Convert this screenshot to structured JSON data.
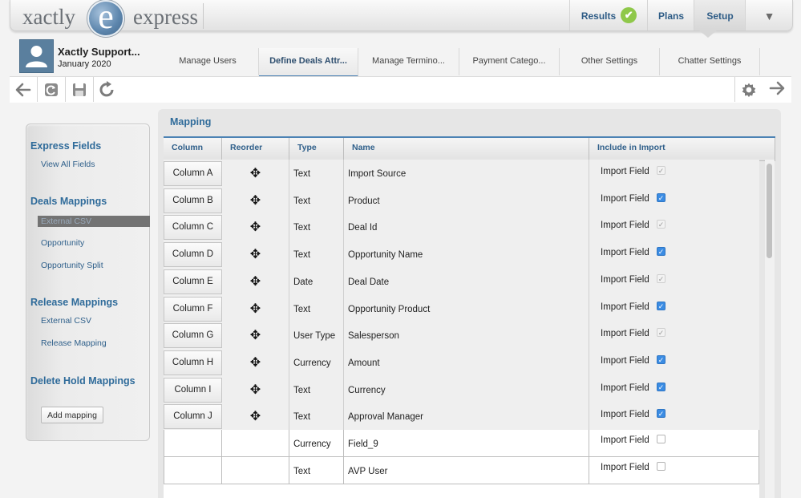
{
  "app": {
    "logo_left": "xactly",
    "logo_mark": "e",
    "logo_right": "express"
  },
  "topnav": {
    "results": "Results",
    "plans": "Plans",
    "setup": "Setup",
    "menu_icon": "▼"
  },
  "user": {
    "name": "Xactly Support...",
    "date": "January 2020"
  },
  "tabs": [
    {
      "label": "Manage Users"
    },
    {
      "label": "Define Deals Attr..."
    },
    {
      "label": "Manage Termino..."
    },
    {
      "label": "Payment Catego..."
    },
    {
      "label": "Other Settings"
    },
    {
      "label": "Chatter Settings"
    }
  ],
  "toolbar": {
    "icons": [
      "back-arrow-icon",
      "refresh-icon",
      "save-icon",
      "redo-icon",
      "gear-icon",
      "forward-arrow-icon"
    ]
  },
  "sidebar": {
    "express_fields": "Express Fields",
    "view_all_fields": "View All Fields",
    "deals_mappings": "Deals Mappings",
    "external_csv_active": "External CSV",
    "opportunity": "Opportunity",
    "opportunity_split": "Opportunity Split",
    "release_mappings": "Release Mappings",
    "release_external_csv": "External CSV",
    "release_mapping": "Release Mapping",
    "delete_hold_mappings": "Delete Hold Mappings",
    "add_mapping": "Add mapping"
  },
  "mapping": {
    "title": "Mapping",
    "headers": {
      "column": "Column",
      "reorder": "Reorder",
      "type": "Type",
      "name": "Name",
      "include": "Include in Import"
    },
    "rows": [
      {
        "column": "Column A",
        "type": "Text",
        "name": "Import Source",
        "include_label": "Import Field",
        "check": "disabled"
      },
      {
        "column": "Column B",
        "type": "Text",
        "name": "Product",
        "include_label": "Import Field",
        "check": "checked"
      },
      {
        "column": "Column C",
        "type": "Text",
        "name": "Deal Id",
        "include_label": "Import Field",
        "check": "disabled"
      },
      {
        "column": "Column D",
        "type": "Text",
        "name": "Opportunity Name",
        "include_label": "Import Field",
        "check": "checked"
      },
      {
        "column": "Column E",
        "type": "Date",
        "name": "Deal Date",
        "include_label": "Import Field",
        "check": "disabled"
      },
      {
        "column": "Column F",
        "type": "Text",
        "name": "Opportunity Product",
        "include_label": "Import Field",
        "check": "checked"
      },
      {
        "column": "Column G",
        "type": "User Type",
        "name": "Salesperson",
        "include_label": "Import Field",
        "check": "disabled"
      },
      {
        "column": "Column H",
        "type": "Currency",
        "name": "Amount",
        "include_label": "Import Field",
        "check": "checked"
      },
      {
        "column": "Column I",
        "type": "Text",
        "name": "Currency",
        "include_label": "Import Field",
        "check": "checked"
      },
      {
        "column": "Column J",
        "type": "Text",
        "name": "Approval Manager",
        "include_label": "Import Field",
        "check": "checked"
      },
      {
        "column": "",
        "type": "Currency",
        "name": "Field_9",
        "include_label": "Import Field",
        "check": "unchecked"
      },
      {
        "column": "",
        "type": "Text",
        "name": "AVP User",
        "include_label": "Import Field",
        "check": "unchecked"
      }
    ]
  },
  "colors": {
    "accent_blue": "#2f6b9a",
    "checkbox_blue": "#3b8ce3",
    "results_green": "#8fc84a"
  }
}
